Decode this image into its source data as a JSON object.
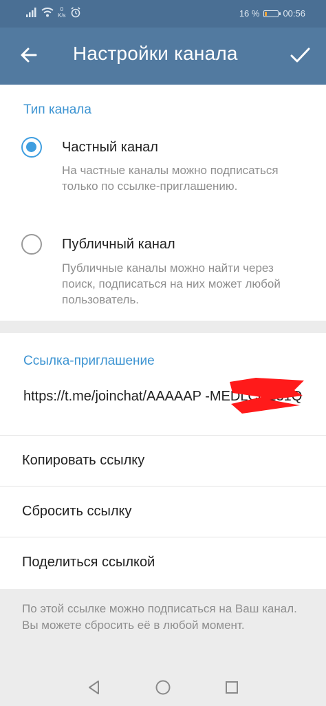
{
  "status_bar": {
    "speed_value": "0",
    "speed_unit": "K/s",
    "battery": "16 %",
    "battery_level_percent": 16,
    "time": "00:56"
  },
  "app_bar": {
    "title": "Настройки канала"
  },
  "channel_type": {
    "section_title": "Тип канала",
    "options": [
      {
        "label": "Частный канал",
        "description": "На частные каналы можно подписаться только по ссылке-приглашению.",
        "selected": true
      },
      {
        "label": "Публичный канал",
        "description": "Публичные каналы можно найти через поиск, подписаться на них может любой пользователь.",
        "selected": false
      }
    ]
  },
  "invite": {
    "section_title": "Ссылка-приглашение",
    "link": "https://t.me/joinchat/AAAAAP          -MEDLCG231Q",
    "actions": [
      {
        "label": "Копировать ссылку"
      },
      {
        "label": "Сбросить ссылку"
      },
      {
        "label": "Поделиться ссылкой"
      }
    ],
    "note": "По этой ссылке можно подписаться на Ваш канал. Вы можете сбросить её в любой момент."
  },
  "colors": {
    "status_bar": "#4a6f94",
    "app_bar": "#527aa0",
    "accent": "#3d94d2",
    "redaction": "#ff1a1a"
  }
}
